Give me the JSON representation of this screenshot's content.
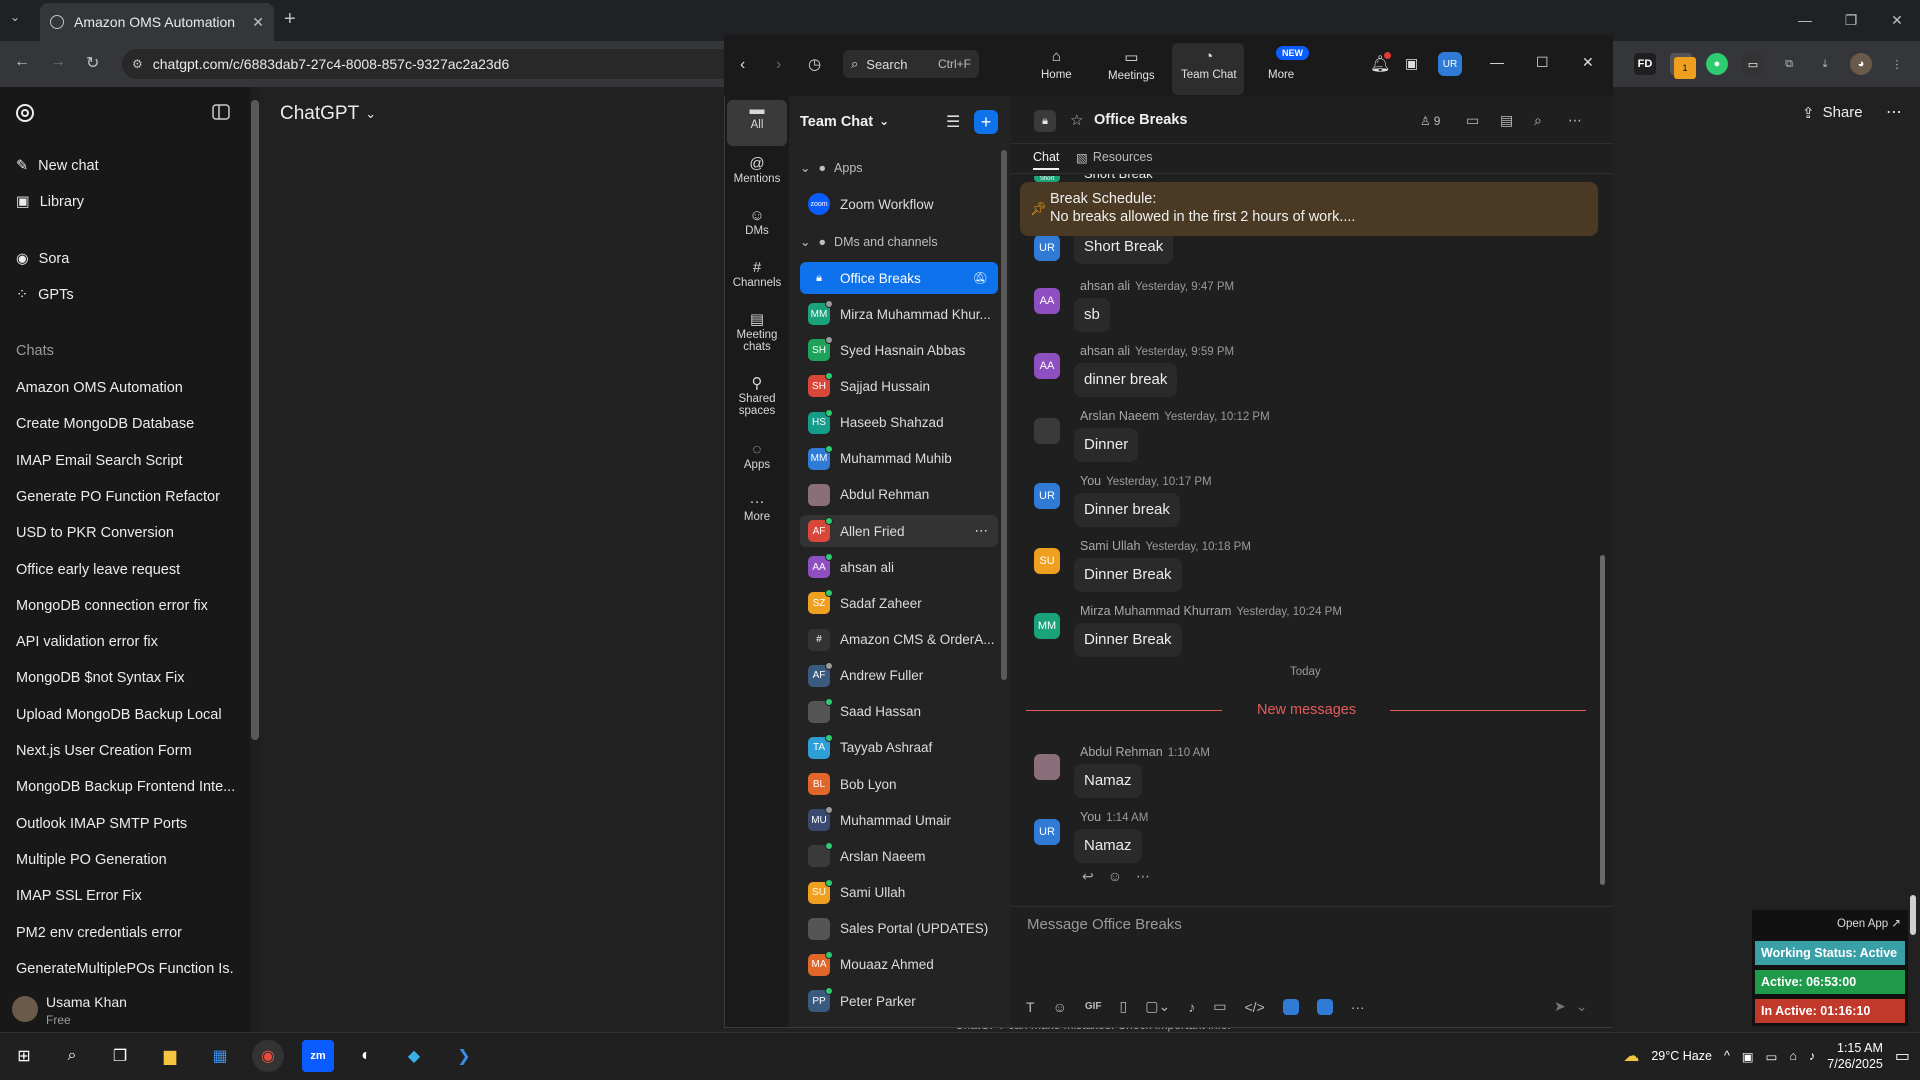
{
  "browser": {
    "tab_title": "Amazon OMS Automation",
    "url": "chatgpt.com/c/6883dab7-27c4-8008-857c-9327ac2a23d6"
  },
  "chatgpt": {
    "model": "ChatGPT",
    "share": "Share",
    "nav": [
      "New chat",
      "Library",
      "Sora",
      "GPTs"
    ],
    "chats_heading": "Chats",
    "chats": [
      "Amazon OMS Automation",
      "Create MongoDB Database",
      "IMAP Email Search Script",
      "Generate PO Function Refactor",
      "USD to PKR Conversion",
      "Office early leave request",
      "MongoDB connection error fix",
      "API validation error fix",
      "MongoDB $not Syntax Fix",
      "Upload MongoDB Backup Local",
      "Next.js User Creation Form",
      "MongoDB Backup Frontend Inte...",
      "Outlook IMAP SMTP Ports",
      "Multiple PO Generation",
      "IMAP SSL Error Fix",
      "PM2 env credentials error",
      "GenerateMultiplePOs Function Is..."
    ],
    "user_name": "Usama Khan",
    "user_plan": "Free",
    "disclaimer": "ChatGPT can make mistakes. Check important info."
  },
  "zoom": {
    "search_label": "Search",
    "search_shortcut": "Ctrl+F",
    "top_nav": [
      "Home",
      "Meetings",
      "Team Chat",
      "More"
    ],
    "new_badge": "NEW",
    "self_initials": "UR",
    "rail": [
      "All",
      "Mentions",
      "DMs",
      "Channels",
      "Meeting chats",
      "Shared spaces",
      "Apps",
      "More"
    ],
    "list_title": "Team Chat",
    "apps_heading": "Apps",
    "apps": [
      "Zoom Workflow"
    ],
    "zoom_app_logo": "zoom",
    "dms_heading": "DMs and channels",
    "channels": [
      {
        "name": "Office Breaks",
        "initials": "",
        "color": "#0e72ed",
        "status": ""
      },
      {
        "name": "Mirza Muhammad Khur...",
        "initials": "MM",
        "color": "#1aa37a",
        "status": "#9a9a9a"
      },
      {
        "name": "Syed Hasnain Abbas",
        "initials": "SH",
        "color": "#1fa35a",
        "status": "#9a9a9a"
      },
      {
        "name": "Sajjad Hussain",
        "initials": "SH",
        "color": "#d9473b",
        "status": "#2ecc71"
      },
      {
        "name": "Haseeb Shahzad",
        "initials": "HS",
        "color": "#169c8a",
        "status": "#2ecc71"
      },
      {
        "name": "Muhammad Muhib",
        "initials": "MM",
        "color": "#2f7bd6",
        "status": "#2ecc71"
      },
      {
        "name": "Abdul Rehman",
        "initials": "",
        "color": "#8a6f7a",
        "status": ""
      },
      {
        "name": "Allen Fried",
        "initials": "AF",
        "color": "#d9473b",
        "status": "#2ecc71"
      },
      {
        "name": "ahsan ali",
        "initials": "AA",
        "color": "#8e4fc0",
        "status": "#2ecc71"
      },
      {
        "name": "Sadaf Zaheer",
        "initials": "SZ",
        "color": "#f0a020",
        "status": "#2ecc71"
      },
      {
        "name": "Amazon CMS & OrderA...",
        "initials": "#",
        "color": "#333333",
        "status": ""
      },
      {
        "name": "Andrew Fuller",
        "initials": "AF",
        "color": "#3a5a80",
        "status": "#9a9a9a"
      },
      {
        "name": "Saad Hassan",
        "initials": "",
        "color": "#555555",
        "status": "#2ecc71"
      },
      {
        "name": "Tayyab Ashraaf",
        "initials": "TA",
        "color": "#2f9ed6",
        "status": "#2ecc71"
      },
      {
        "name": "Bob Lyon",
        "initials": "BL",
        "color": "#e0662a",
        "status": ""
      },
      {
        "name": "Muhammad Umair",
        "initials": "MU",
        "color": "#3a4a70",
        "status": "#9a9a9a"
      },
      {
        "name": "Arslan Naeem",
        "initials": "",
        "color": "#3a3a3a",
        "status": "#2ecc71"
      },
      {
        "name": "Sami Ullah",
        "initials": "SU",
        "color": "#f0a020",
        "status": "#2ecc71"
      },
      {
        "name": "Sales Portal (UPDATES)",
        "initials": "",
        "color": "#555555",
        "status": ""
      },
      {
        "name": "Mouaaz Ahmed",
        "initials": "MA",
        "color": "#e0662a",
        "status": "#2ecc71"
      },
      {
        "name": "Peter Parker",
        "initials": "PP",
        "color": "#3a5a80",
        "status": "#2ecc71"
      }
    ],
    "chat": {
      "title": "Office Breaks",
      "members": "9",
      "tabs": [
        "Chat",
        "Resources"
      ],
      "pinned_title": "Break Schedule:",
      "pinned_text": "No breaks allowed in the first 2 hours of work....",
      "cut_top_text": "Short Break",
      "cut_top_initials": "MM",
      "today": "Today",
      "new_messages": "New messages",
      "composer_placeholder": "Message Office Breaks",
      "gif_label": "GIF",
      "messages": [
        {
          "initials": "UR",
          "color": "#2f7bd6",
          "author": "",
          "time": "",
          "text": "Short Break"
        },
        {
          "initials": "AA",
          "color": "#8e4fc0",
          "author": "ahsan ali",
          "time": "Yesterday, 9:47 PM",
          "text": "sb"
        },
        {
          "initials": "AA",
          "color": "#8e4fc0",
          "author": "ahsan ali",
          "time": "Yesterday, 9:59 PM",
          "text": "dinner break"
        },
        {
          "initials": "",
          "color": "#3a3a3a",
          "author": "Arslan Naeem",
          "time": "Yesterday, 10:12 PM",
          "text": "Dinner"
        },
        {
          "initials": "UR",
          "color": "#2f7bd6",
          "author": "You",
          "time": "Yesterday, 10:17 PM",
          "text": "Dinner break"
        },
        {
          "initials": "SU",
          "color": "#f0a020",
          "author": "Sami Ullah",
          "time": "Yesterday, 10:18 PM",
          "text": "Dinner Break"
        },
        {
          "initials": "MM",
          "color": "#1aa37a",
          "author": "Mirza Muhammad Khurram",
          "time": "Yesterday, 10:24 PM",
          "text": "Dinner Break"
        },
        {
          "initials": "",
          "color": "#8a6f7a",
          "author": "Abdul Rehman",
          "time": "1:10 AM",
          "text": "Namaz"
        },
        {
          "initials": "UR",
          "color": "#2f7bd6",
          "author": "You",
          "time": "1:14 AM",
          "text": "Namaz"
        }
      ]
    }
  },
  "widget": {
    "open_app": "Open App ↗",
    "working": "Working Status: Active",
    "active": "Active: 06:53:00",
    "inactive": "In Active: 01:16:10"
  },
  "taskbar": {
    "weather": "29°C  Haze",
    "time": "1:15 AM",
    "date": "7/26/2025"
  },
  "extensions": {
    "fd_label": "FD",
    "badge_count": "1"
  },
  "colors": {
    "zoom_blue": "#0e72ed",
    "new_messages_red": "#e25c5c",
    "working_status": "#3aa0a8",
    "active": "#1f9a4a",
    "inactive": "#c0392b"
  }
}
